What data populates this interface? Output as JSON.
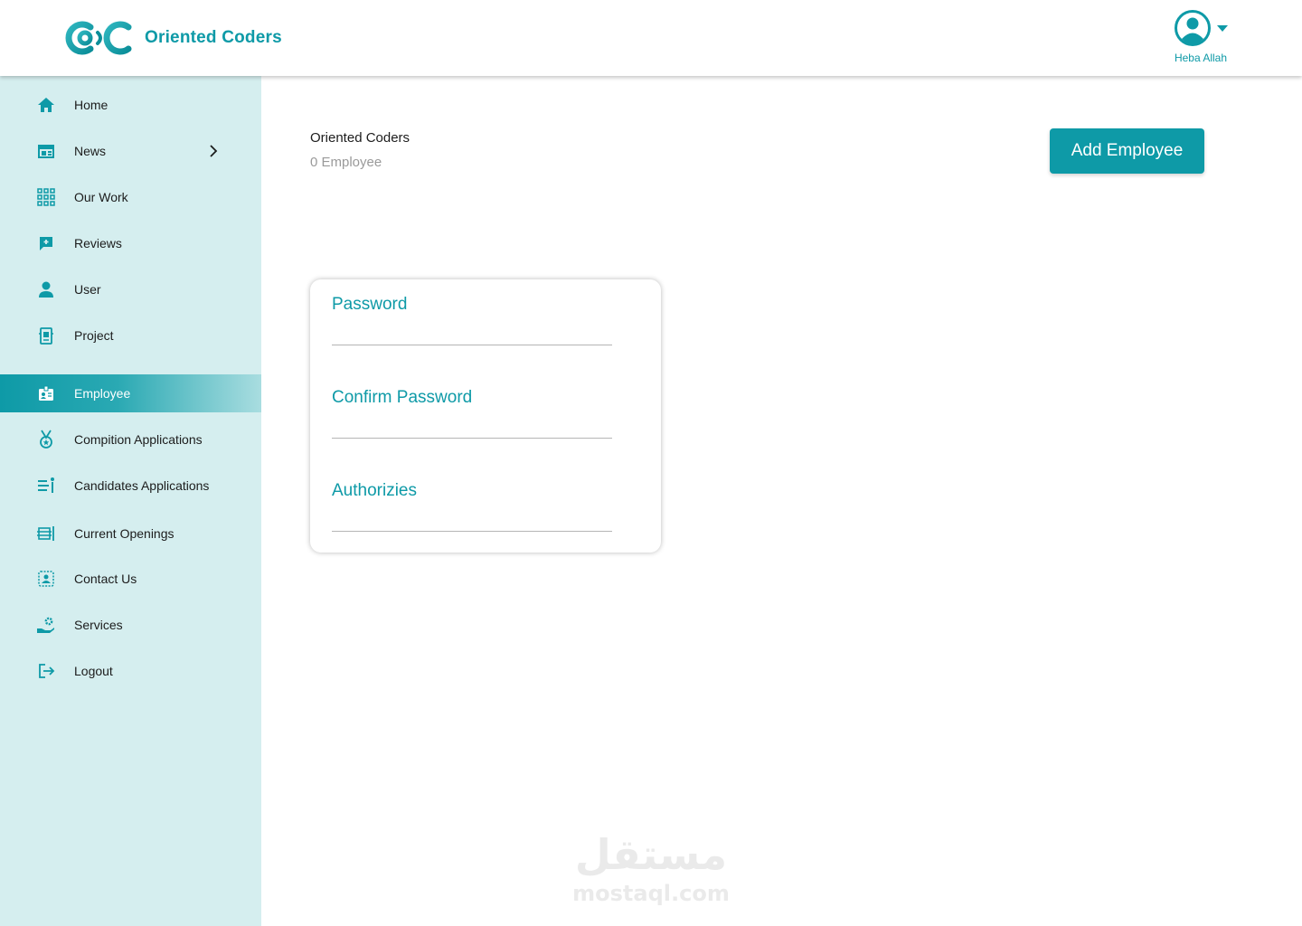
{
  "header": {
    "brand": "Oriented Coders",
    "user_name": "Heba Allah"
  },
  "colors": {
    "accent": "#0e9aa7",
    "sidebar_bg": "#d5eeef"
  },
  "sidebar": {
    "items": [
      {
        "label": "Home",
        "icon": "home-icon"
      },
      {
        "label": "News",
        "icon": "news-icon",
        "has_submenu": true
      },
      {
        "label": "Our Work",
        "icon": "grid-icon"
      },
      {
        "label": "Reviews",
        "icon": "review-icon"
      },
      {
        "label": "User",
        "icon": "user-icon"
      },
      {
        "label": "Project",
        "icon": "project-icon"
      },
      {
        "label": "Employee",
        "icon": "badge-icon",
        "active": true
      },
      {
        "label": "Compition Applications",
        "icon": "medal-icon"
      },
      {
        "label": "Candidates Applications",
        "icon": "candidates-icon"
      },
      {
        "label": "Current Openings",
        "icon": "openings-icon"
      },
      {
        "label": "Contact Us",
        "icon": "contact-icon"
      },
      {
        "label": "Services",
        "icon": "services-icon"
      },
      {
        "label": "Logout",
        "icon": "logout-icon"
      }
    ]
  },
  "main": {
    "org_name": "Oriented Coders",
    "employee_count": "0 Employee",
    "add_button": "Add Employee",
    "form": {
      "password_label": "Password",
      "confirm_label": "Confirm Password",
      "authorizies_label": "Authorizies"
    }
  },
  "watermark": {
    "arabic": "مستقل",
    "latin": "mostaql.com"
  }
}
